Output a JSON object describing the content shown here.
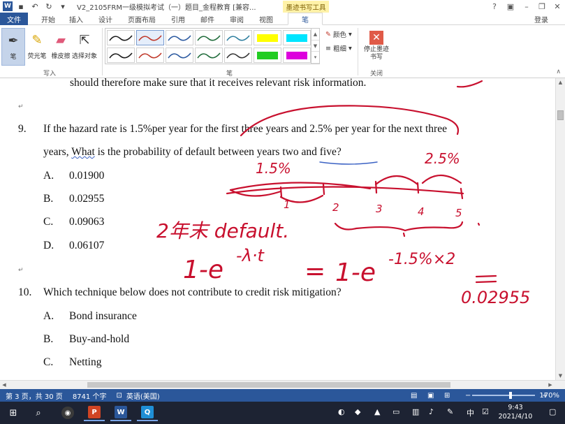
{
  "titlebar": {
    "app_icon": "W",
    "doc_title": "V2_2105FRM一级模拟考试（一）题目_金程教育 [兼容...",
    "context_tab": "墨迹书写工具",
    "icons": [
      "save-icon",
      "undo-icon",
      "redo-icon",
      "more-icon"
    ]
  },
  "window_controls": {
    "help": "?",
    "restore_ribbon": "▣",
    "minimize": "–",
    "maximize": "❐",
    "close": "✕"
  },
  "tabs": [
    "文件",
    "开始",
    "插入",
    "设计",
    "页面布局",
    "引用",
    "邮件",
    "审阅",
    "视图",
    "笔"
  ],
  "active_tab": "笔",
  "login": "登录",
  "ribbon": {
    "write_tools": [
      {
        "label": "笔",
        "icon": "pen-icon"
      },
      {
        "label": "荧光笔",
        "icon": "highlighter-icon"
      },
      {
        "label": "橡皮擦",
        "icon": "eraser-icon"
      },
      {
        "label": "选择对象",
        "icon": "select-cursor-icon"
      }
    ],
    "group_write": "写入",
    "group_pen": "笔",
    "group_close": "关闭",
    "color_label": "颜色",
    "thickness_label": "粗细",
    "stop_label": "停止墨迹书写",
    "pen_colors": [
      "#1a1a1a",
      "#c0392b",
      "#2c5aa0",
      "#1f6b3a",
      "#2f7f9f",
      "#ffff00",
      "#00e5ff",
      "#1a1a1a",
      "#c0392b",
      "#2c5aa0",
      "#1f6b3a",
      "#333333",
      "#22cc22",
      "#dd00dd"
    ]
  },
  "document": {
    "prev_line": "should therefore make sure that it receives relevant risk information.",
    "q9": {
      "number": "9.",
      "line1": "If the hazard rate is 1.5%per year for the first three years and 2.5% per year for the next three",
      "line2_pre": "years, ",
      "line2_what": "What",
      "line2_post": " is the probability of default between years two and five?",
      "options": [
        {
          "letter": "A.",
          "text": "0.01900"
        },
        {
          "letter": "B.",
          "text": "0.02955"
        },
        {
          "letter": "C.",
          "text": "0.09063"
        },
        {
          "letter": "D.",
          "text": "0.06107"
        }
      ]
    },
    "q10": {
      "number": "10.",
      "text": "Which technique below does not contribute to credit risk mitigation?",
      "options": [
        {
          "letter": "A.",
          "text": "Bond insurance"
        },
        {
          "letter": "B.",
          "text": "Buy-and-hold"
        },
        {
          "letter": "C.",
          "text": "Netting"
        }
      ]
    },
    "marks": {
      "para": "↵",
      "tiny": "↵"
    },
    "ink": {
      "rate1": "1.5%",
      "rate2": "2.5%",
      "ticks": [
        "1",
        "2",
        "3",
        "4",
        "5"
      ],
      "note": "2年末 default.",
      "formula_left": "1-e",
      "formula_left_exp": "-λ·t",
      "equals": "=",
      "formula_right": "1-e",
      "formula_right_exp": "-1.5%×2",
      "result": "0.02955"
    }
  },
  "status": {
    "page": "第 3 页，共 30 页",
    "words": "8741 个字",
    "lang": "英语(美国)",
    "zoom": "170%",
    "zoom_level": 0.62,
    "zoom_minus": "−",
    "zoom_plus": "+"
  },
  "taskbar": {
    "apps": [
      {
        "name": "obs",
        "glyph": "◉",
        "color": "#3a3a3a"
      },
      {
        "name": "powerpoint",
        "glyph": "P",
        "color": "#d04423"
      },
      {
        "name": "word",
        "glyph": "W",
        "color": "#2b579a"
      },
      {
        "name": "other",
        "glyph": "Q",
        "color": "#1f8fd6"
      }
    ],
    "ime": "中",
    "time": "9:43",
    "date": "2021/4/10"
  }
}
